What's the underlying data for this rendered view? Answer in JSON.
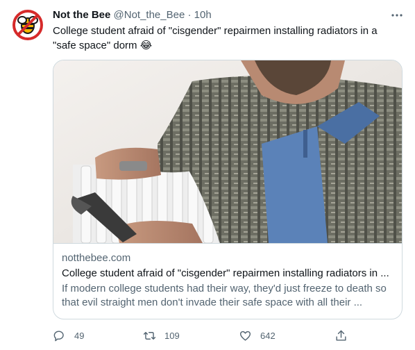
{
  "tweet": {
    "author_name": "Not the Bee",
    "author_handle": "@Not_the_Bee",
    "separator": "·",
    "time": "10h",
    "text": "College student afraid of \"cisgender\" repairmen installing radiators in a \"safe space\" dorm 😂",
    "more_icon": "more-horizontal-icon"
  },
  "card": {
    "domain": "notthebee.com",
    "title": "College student afraid of \"cisgender\" repairmen installing radiators in ...",
    "description": "If modern college students had their way, they'd just freeze to death so that evil straight men don't invade their safe space with all their ..."
  },
  "actions": {
    "reply_count": "49",
    "retweet_count": "109",
    "like_count": "642",
    "icons": [
      "reply-icon",
      "retweet-icon",
      "like-icon",
      "share-icon"
    ]
  },
  "colors": {
    "text_primary": "#0f1419",
    "text_secondary": "#536471",
    "border": "#cfd9de",
    "avatar_red": "#d62a2a",
    "avatar_yellow": "#f5b700"
  }
}
